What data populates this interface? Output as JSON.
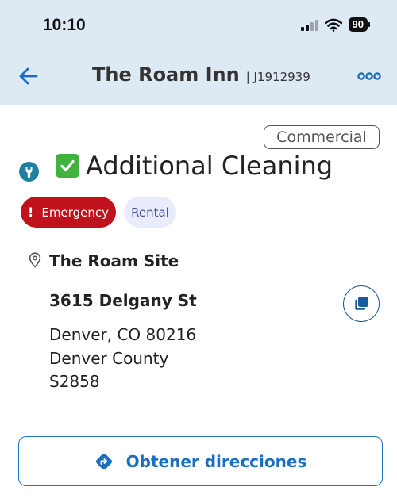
{
  "status_bar": {
    "time": "10:10",
    "battery": "90"
  },
  "header": {
    "title": "The Roam Inn",
    "job_id": "| J1912939"
  },
  "job": {
    "type_badge": "Commercial",
    "title": "Additional Cleaning",
    "tags": {
      "emergency": "Emergency",
      "emergency_mark": "!",
      "rental": "Rental"
    }
  },
  "site": {
    "name": "The Roam Site",
    "street": "3615 Delgany St",
    "city_line": "Denver, CO 80216",
    "county": "Denver County",
    "site_code": "S2858"
  },
  "actions": {
    "directions_label": "Obtener direcciones"
  },
  "colors": {
    "header_bg": "#dde9f3",
    "accent_blue": "#1a6fc2",
    "emergency_red": "#c0121c",
    "rental_bg": "#e9edfb",
    "wrench_teal": "#1f7fa0"
  }
}
